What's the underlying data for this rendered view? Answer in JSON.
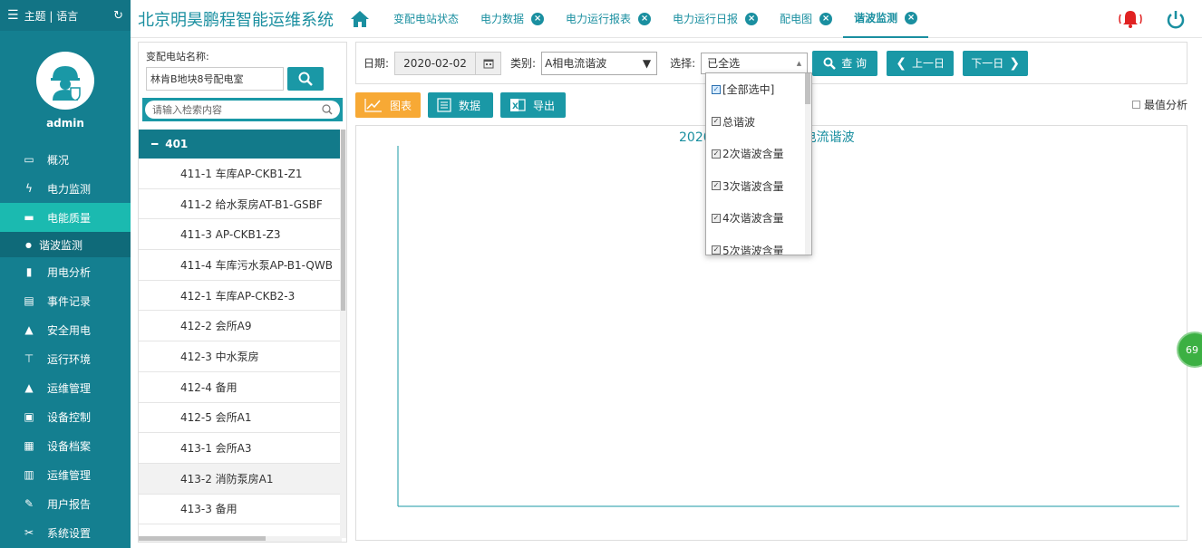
{
  "sidebar": {
    "top_label": "主题 | 语言",
    "user": "admin",
    "items": [
      {
        "label": "概况",
        "icon": "monitor-icon"
      },
      {
        "label": "电力监测",
        "icon": "lightning-icon"
      },
      {
        "label": "电能质量",
        "icon": "folder-icon",
        "active": true
      },
      {
        "label": "用电分析",
        "icon": "bar-chart-icon"
      },
      {
        "label": "事件记录",
        "icon": "document-icon"
      },
      {
        "label": "安全用电",
        "icon": "alarm-icon"
      },
      {
        "label": "运行环境",
        "icon": "signpost-icon"
      },
      {
        "label": "运维管理",
        "icon": "worker-icon"
      },
      {
        "label": "设备控制",
        "icon": "control-icon"
      },
      {
        "label": "设备档案",
        "icon": "archive-icon"
      },
      {
        "label": "运维管理",
        "icon": "grid-icon"
      },
      {
        "label": "用户报告",
        "icon": "edit-icon"
      },
      {
        "label": "系统设置",
        "icon": "wrench-icon"
      }
    ],
    "sub_item": "谐波监测"
  },
  "header": {
    "title": "北京明昊鹏程智能运维系统",
    "tabs": [
      {
        "label": "变配电站状态",
        "closable": false
      },
      {
        "label": "电力数据",
        "closable": true
      },
      {
        "label": "电力运行报表",
        "closable": true
      },
      {
        "label": "电力运行日报",
        "closable": true
      },
      {
        "label": "配电图",
        "closable": true
      },
      {
        "label": "谐波监测",
        "closable": true,
        "active": true
      }
    ]
  },
  "left_panel": {
    "station_label": "变配电站名称:",
    "station_value": "林肯B地块8号配电室",
    "search_placeholder": "请输入检索内容",
    "group": "401",
    "items": [
      "411-1 车库AP-CKB1-Z1",
      "411-2 给水泵房AT-B1-GSBF",
      "411-3 AP-CKB1-Z3",
      "411-4 车库污水泵AP-B1-QWB",
      "412-1 车库AP-CKB2-3",
      "412-2 会所A9",
      "412-3 中水泵房",
      "412-4 备用",
      "412-5 会所A1",
      "413-1 会所A3",
      "413-2 消防泵房A1",
      "413-3 备用"
    ]
  },
  "toolbar": {
    "date_label": "日期:",
    "date_value": "2020-02-02",
    "type_label": "类别:",
    "type_value": "A相电流谐波",
    "select_label": "选择:",
    "select_value": "已全选",
    "query": "查 询",
    "prev": "上一日",
    "next": "下一日"
  },
  "actions": {
    "chart": "图表",
    "data": "数据",
    "export": "导出",
    "max_analysis": "最值分析"
  },
  "chart": {
    "title_left": "2020",
    "title_right": "电流谐波"
  },
  "dropdown": {
    "items": [
      "[全部选中]",
      "总谐波",
      "2次谐波含量",
      "3次谐波含量",
      "4次谐波含量",
      "5次谐波含量"
    ]
  },
  "badge": "69",
  "colors": {
    "primary": "#1a98a6",
    "sidebar": "#147f90",
    "active": "#1bbab0",
    "orange": "#f7a935",
    "alarm": "#e02222"
  }
}
